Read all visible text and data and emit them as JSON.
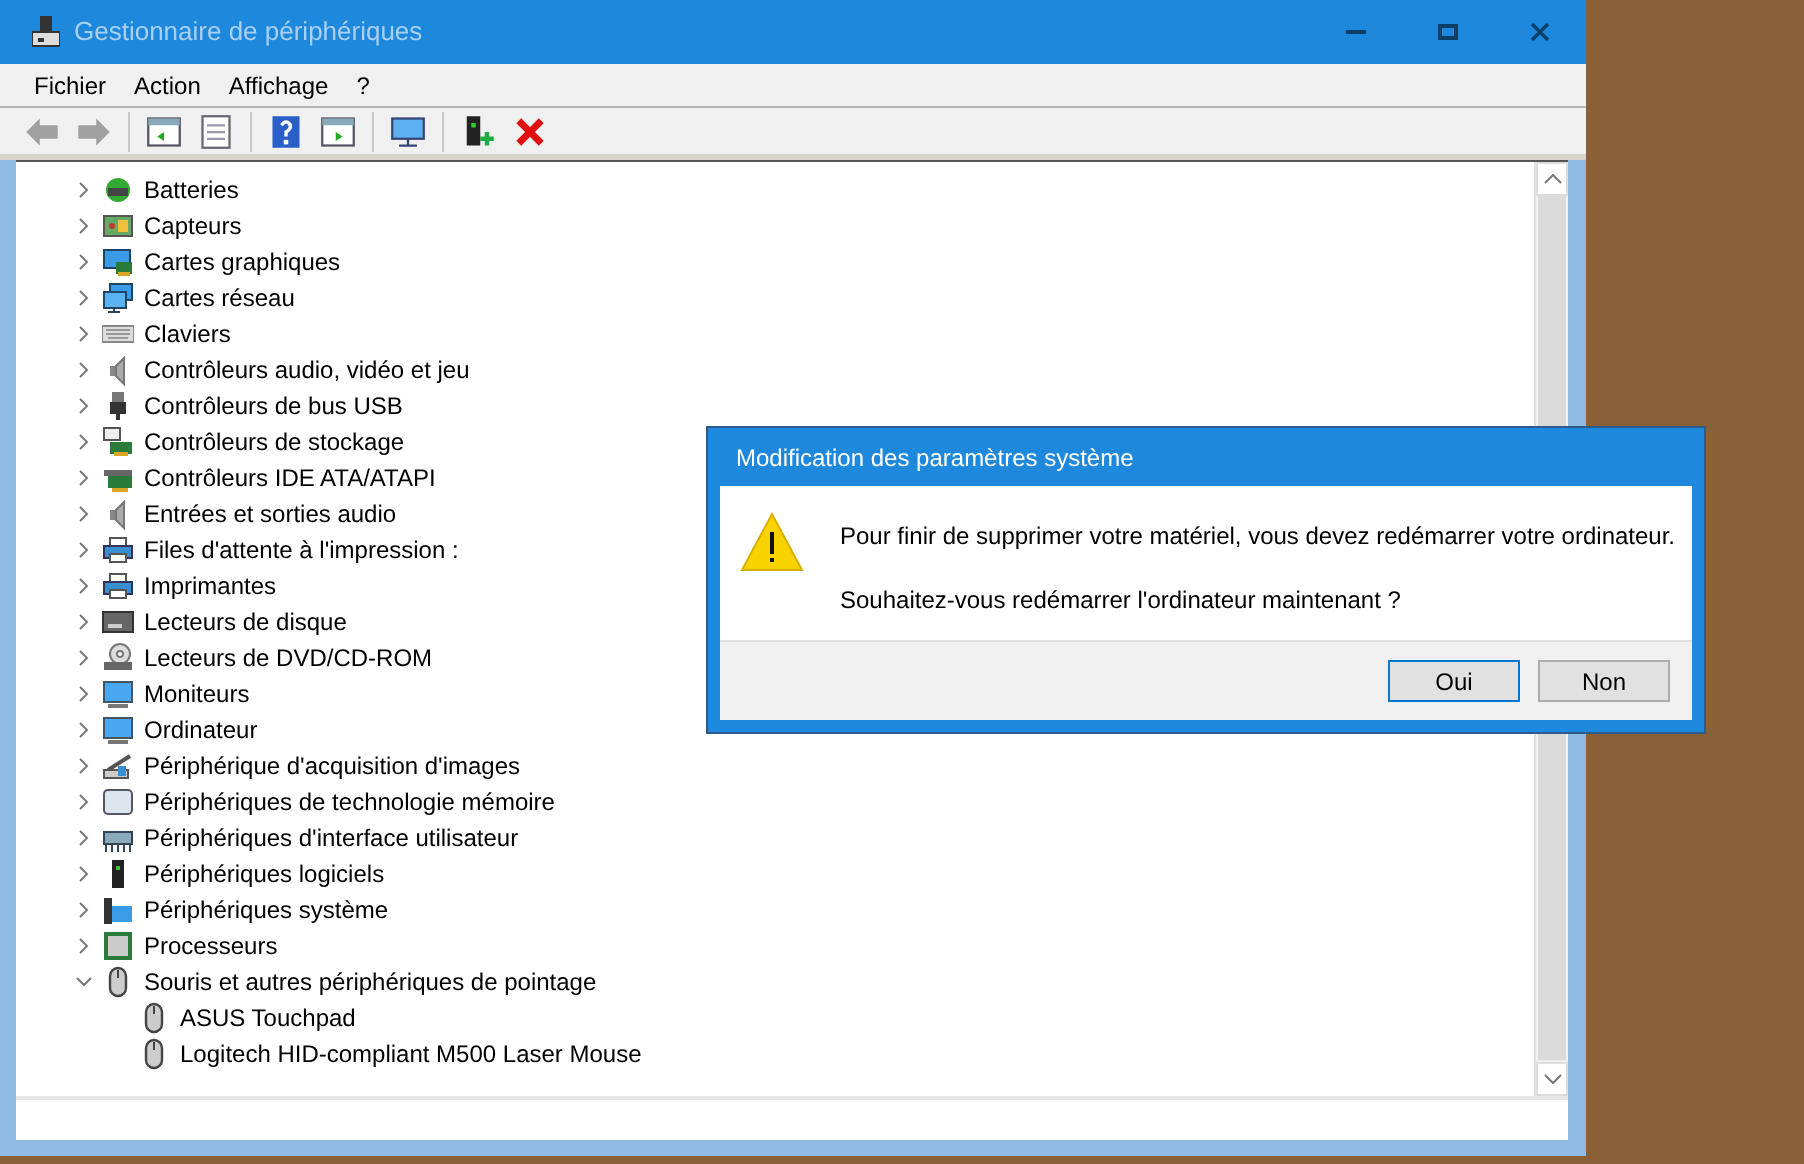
{
  "window": {
    "title": "Gestionnaire de périphériques",
    "active": false
  },
  "menu": [
    {
      "label": "Fichier"
    },
    {
      "label": "Action"
    },
    {
      "label": "Affichage"
    },
    {
      "label": "?"
    }
  ],
  "toolbar": [
    {
      "disabled": true
    },
    {
      "disabled": true
    },
    {
      "disabled": false
    },
    {
      "disabled": false
    },
    {
      "disabled": false
    },
    {
      "disabled": false
    },
    {
      "disabled": false
    },
    {
      "disabled": false
    },
    {
      "disabled": false
    }
  ],
  "tree": [
    {
      "label": "Batteries",
      "expanded": false
    },
    {
      "label": "Capteurs",
      "expanded": false
    },
    {
      "label": "Cartes graphiques",
      "expanded": false
    },
    {
      "label": "Cartes réseau",
      "expanded": false
    },
    {
      "label": "Claviers",
      "expanded": false
    },
    {
      "label": "Contrôleurs audio, vidéo et jeu",
      "expanded": false
    },
    {
      "label": "Contrôleurs de bus USB",
      "expanded": false
    },
    {
      "label": "Contrôleurs de stockage",
      "expanded": false
    },
    {
      "label": "Contrôleurs IDE ATA/ATAPI",
      "expanded": false
    },
    {
      "label": "Entrées et sorties audio",
      "expanded": false
    },
    {
      "label": "Files d'attente à l'impression :",
      "expanded": false
    },
    {
      "label": "Imprimantes",
      "expanded": false
    },
    {
      "label": "Lecteurs de disque",
      "expanded": false
    },
    {
      "label": "Lecteurs de DVD/CD-ROM",
      "expanded": false
    },
    {
      "label": "Moniteurs",
      "expanded": false
    },
    {
      "label": "Ordinateur",
      "expanded": false
    },
    {
      "label": "Périphérique d'acquisition d'images",
      "expanded": false
    },
    {
      "label": "Périphériques de technologie mémoire",
      "expanded": false
    },
    {
      "label": "Périphériques d'interface utilisateur",
      "expanded": false
    },
    {
      "label": "Périphériques logiciels",
      "expanded": false
    },
    {
      "label": "Périphériques système",
      "expanded": false
    },
    {
      "label": "Processeurs",
      "expanded": false
    },
    {
      "label": "Souris et autres périphériques de pointage",
      "expanded": true,
      "children": [
        {
          "label": "ASUS Touchpad"
        },
        {
          "label": "Logitech HID-compliant M500 Laser Mouse"
        }
      ]
    }
  ],
  "dialog": {
    "title": "Modification des paramètres système",
    "message": "Pour finir de supprimer votre matériel, vous devez redémarrer votre ordinateur.",
    "question": "Souhaitez-vous redémarrer l'ordinateur maintenant ?",
    "buttons": [
      {
        "label": "Oui",
        "default": true
      },
      {
        "label": "Non",
        "default": false
      }
    ]
  }
}
